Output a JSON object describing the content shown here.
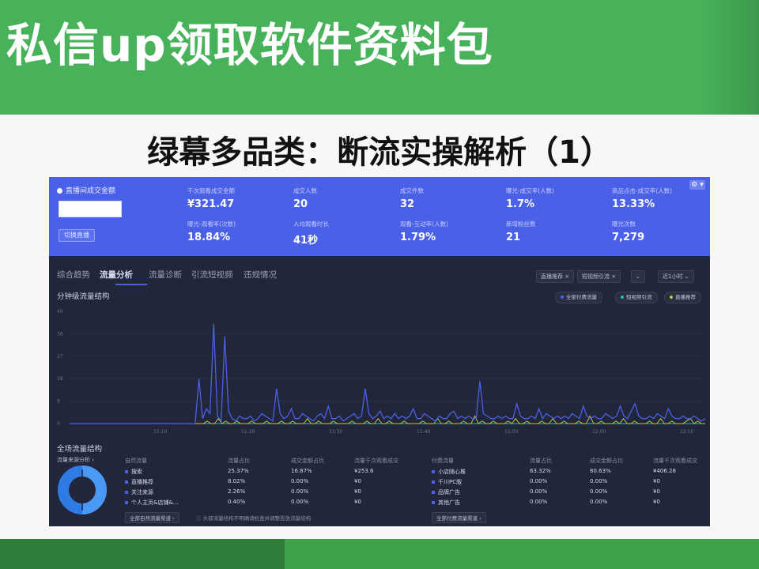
{
  "promo_text": "私信up领取软件资料包",
  "slide_title": "绿幕多品类：断流实操解析（1）",
  "dashboard": {
    "room_label": "直播间成交金额",
    "room_button": "切换直播",
    "gear": "⚙ ▾",
    "metrics": [
      {
        "label": "千次观看成交金额",
        "value": "¥321.47"
      },
      {
        "label": "成交人数",
        "value": "20"
      },
      {
        "label": "成交件数",
        "value": "32"
      },
      {
        "label": "曝光-成交率(人数)",
        "value": "1.7%"
      },
      {
        "label": "商品点击-成交率(人数)",
        "value": "13.33%"
      },
      {
        "label": "曝光-观看率(次数)",
        "value": "18.84%"
      },
      {
        "label": "人均观看时长",
        "value": "41秒"
      },
      {
        "label": "观看-互动率(人数)",
        "value": "1.79%"
      },
      {
        "label": "新增粉丝数",
        "value": "21"
      },
      {
        "label": "曝光次数",
        "value": "7,279"
      }
    ],
    "tabs": [
      "综合趋势",
      "流量分析",
      "流量诊断",
      "引流短视频",
      "违规情况"
    ],
    "filters": [
      "直播推荐 ×",
      "短视频引流 ×",
      "⌄",
      "近1小时 ⌄"
    ],
    "chart_title": "分钟级流量结构",
    "legend": [
      "全部付费流量",
      "短视频引流",
      "直播推荐"
    ],
    "colors": {
      "blue": "#4a60e6",
      "yellow": "#c8c23a",
      "teal": "#2bb5c2",
      "bg": "#22263a"
    },
    "table_title": "全场流量结构",
    "donut_label": "流量来源分析 ›",
    "left_table": {
      "headers": [
        "自然流量",
        "流量占比",
        "成交金额占比",
        "流量千次观看成交"
      ],
      "rows": [
        [
          "搜索",
          "25.37%",
          "16.87%",
          "¥253.6"
        ],
        [
          "直播推荐",
          "8.02%",
          "0.00%",
          "¥0"
        ],
        [
          "关注来源",
          "2.26%",
          "0.00%",
          "¥0"
        ],
        [
          "个人主页&店铺&...",
          "0.40%",
          "0.00%",
          "¥0"
        ]
      ],
      "footer": "全部自然流量渠道 ›"
    },
    "right_table": {
      "headers": [
        "付费流量",
        "流量占比",
        "成交金额占比",
        "流量千次观看成交"
      ],
      "rows": [
        [
          "小店随心推",
          "63.32%",
          "80.63%",
          "¥406.28"
        ],
        [
          "千川PC版",
          "0.00%",
          "0.00%",
          "¥0"
        ],
        [
          "品牌广告",
          "0.00%",
          "0.00%",
          "¥0"
        ],
        [
          "其他广告",
          "0.00%",
          "0.00%",
          "¥0"
        ]
      ],
      "footer": "全部付费流量渠道 ›"
    },
    "warning": "ⓘ 头部流量结构不明确请检查并调整投放流量结构"
  },
  "chart_data": {
    "type": "line",
    "title": "分钟级流量结构",
    "ylim": [
      0,
      45
    ],
    "yticks": [
      "45",
      "36",
      "27",
      "18",
      "9",
      "0"
    ],
    "xticks": [
      "11:10",
      "11:20",
      "11:30",
      "11:40",
      "11:50",
      "12:00",
      "12:10",
      "12:20"
    ],
    "series": [
      {
        "name": "全部付费流量",
        "color": "#4a60e6",
        "values": [
          0,
          0,
          0,
          0,
          0,
          0,
          0,
          0,
          0,
          0,
          0,
          0,
          0,
          0,
          0,
          0,
          0,
          0,
          0,
          0,
          0,
          0,
          0,
          0,
          0,
          0,
          0,
          0,
          0,
          0,
          0,
          0,
          0,
          0,
          0,
          18,
          2,
          6,
          4,
          40,
          3,
          1,
          35,
          5,
          2,
          1,
          3,
          2,
          2,
          3,
          1,
          2,
          4,
          3,
          2,
          1,
          14,
          4,
          2,
          3,
          6,
          2,
          2,
          4,
          3,
          2,
          1,
          3,
          4,
          2,
          7,
          2,
          2,
          3,
          1,
          2,
          3,
          4,
          2,
          3,
          14,
          4,
          2,
          3,
          5,
          2,
          3,
          2,
          4,
          2,
          3,
          2,
          3,
          6,
          2,
          2,
          4,
          3,
          2,
          1,
          3,
          2,
          2,
          4,
          5,
          2,
          3,
          2,
          3,
          2,
          2,
          17,
          4,
          3,
          2,
          2,
          3,
          2,
          3,
          2,
          2,
          8,
          3,
          2,
          2,
          3,
          2,
          6,
          2,
          4,
          3,
          2,
          3,
          2,
          3,
          2,
          4,
          3,
          2,
          7,
          3,
          2,
          3,
          2,
          2,
          4,
          3,
          2,
          3,
          7,
          3,
          2,
          5,
          8,
          3,
          2,
          2,
          3,
          2,
          4,
          3,
          2,
          6,
          3,
          2,
          2,
          3,
          2,
          2,
          3,
          2,
          1,
          2
        ]
      },
      {
        "name": "直播推荐",
        "color": "#c8c23a",
        "values": [
          0,
          0,
          0,
          0,
          0,
          0,
          0,
          0,
          0,
          0,
          0,
          0,
          0,
          0,
          0,
          0,
          0,
          0,
          0,
          0,
          0,
          0,
          0,
          0,
          0,
          0,
          0,
          0,
          0,
          0,
          0,
          0,
          0,
          0,
          0,
          0,
          0,
          1,
          0,
          0,
          2,
          0,
          1,
          0,
          0,
          1,
          0,
          0,
          0,
          1,
          0,
          0,
          0,
          1,
          0,
          0,
          0,
          1,
          0,
          0,
          1,
          0,
          0,
          0,
          2,
          0,
          0,
          1,
          0,
          0,
          0,
          1,
          0,
          0,
          0,
          0,
          1,
          0,
          0,
          0,
          1,
          0,
          0,
          2,
          0,
          0,
          1,
          0,
          0,
          0,
          1,
          0,
          0,
          0,
          0,
          1,
          0,
          0,
          0,
          2,
          0,
          0,
          1,
          0,
          0,
          0,
          1,
          0,
          0,
          3,
          0,
          1,
          0,
          0,
          1,
          0,
          0,
          0,
          1,
          0,
          2,
          0,
          0,
          1,
          0,
          0,
          0,
          1,
          0,
          0,
          2,
          0,
          0,
          1,
          0,
          0,
          0,
          1,
          0,
          0,
          3,
          0,
          0,
          1,
          0,
          0,
          0,
          1,
          0,
          2,
          0,
          0,
          1,
          0,
          0,
          0,
          1,
          0,
          0,
          2,
          0,
          0,
          1,
          0,
          0,
          0,
          1,
          2,
          0,
          1,
          0,
          0
        ]
      },
      {
        "name": "短视频引流",
        "color": "#2bb5c2",
        "values": [
          0,
          0,
          0,
          0,
          0,
          0,
          0,
          0,
          0,
          0,
          0,
          0,
          0,
          0,
          0,
          0,
          0,
          0,
          0,
          0,
          0,
          0,
          0,
          0,
          0,
          0,
          0,
          0,
          0,
          0,
          0,
          0,
          0,
          0,
          0,
          0,
          0,
          0,
          0,
          0,
          0,
          0,
          0,
          0,
          0,
          0,
          0,
          0,
          0,
          0,
          0,
          0,
          0,
          0,
          0,
          0,
          0,
          0,
          0,
          0,
          0,
          0,
          0,
          0,
          0,
          0,
          0,
          0,
          0,
          0,
          0,
          0,
          0,
          0,
          0,
          0,
          0,
          0,
          0,
          0,
          0,
          0,
          0,
          0,
          0,
          0,
          0,
          0,
          0,
          0,
          0,
          0,
          0,
          0,
          0,
          0,
          0,
          0,
          0,
          0,
          0,
          0,
          0,
          0,
          0,
          0,
          0,
          0,
          0,
          0,
          0,
          0,
          0,
          0,
          0,
          0,
          0,
          0,
          0,
          0,
          0,
          0,
          0,
          0,
          0,
          0,
          0,
          0,
          0,
          0,
          0,
          0,
          0,
          0,
          0,
          0,
          0,
          0,
          0,
          0,
          0,
          0,
          0,
          0,
          0,
          0,
          0,
          0,
          0,
          0,
          0,
          0,
          0,
          0,
          0,
          0,
          0,
          0,
          0,
          0,
          0,
          0,
          0,
          0,
          0,
          0,
          0,
          0,
          0,
          0,
          0,
          0
        ]
      }
    ]
  }
}
